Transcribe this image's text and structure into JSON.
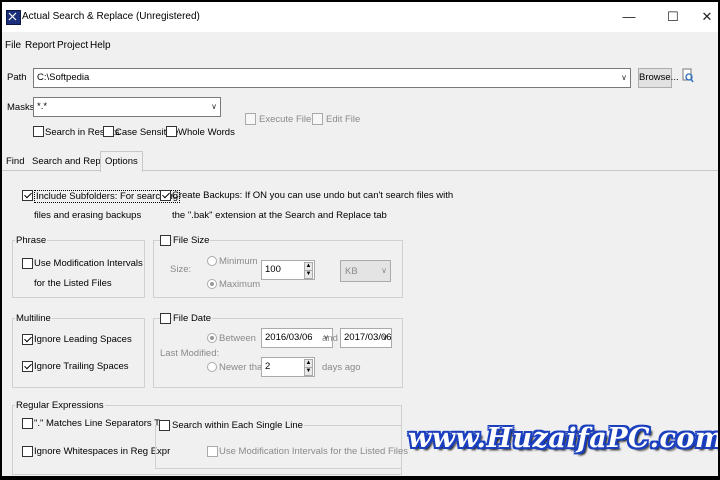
{
  "window": {
    "title": "Actual Search & Replace (Unregistered)"
  },
  "menu": {
    "file": "File",
    "report": "Report",
    "project": "Project",
    "help": "Help"
  },
  "path": {
    "label": "Path",
    "value": "C:\\Softpedia",
    "browse_label": "Browse..."
  },
  "masks": {
    "label": "Masks",
    "value": "*.*"
  },
  "search_opts": {
    "in_results": "Search in Results",
    "case_sensitive": "Case Sensitive",
    "whole_words": "Whole Words"
  },
  "actions": {
    "execute": "Execute File",
    "edit": "Edit File"
  },
  "tabs": [
    "Find",
    "Search and Replace",
    "Options"
  ],
  "options": {
    "include_subfolders_1": "Include Subfolders: For searching",
    "include_subfolders_2": "files and erasing backups",
    "create_backups_1": "Create Backups: If ON you can use undo but can't search files with",
    "create_backups_2": "the \".bak\" extension at the Search and Replace tab",
    "phrase": {
      "title": "Phrase",
      "mod_intervals_1": "Use Modification Intervals",
      "mod_intervals_2": "for the Listed Files"
    },
    "file_size": {
      "title": "File Size",
      "size_label": "Size:",
      "minimum": "Minimum",
      "maximum": "Maximum",
      "value": "100",
      "unit": "KB"
    },
    "multiline": {
      "title": "Multiline",
      "ignore_leading": "Ignore Leading Spaces",
      "ignore_trailing": "Ignore Trailing Spaces"
    },
    "file_date": {
      "title": "File Date",
      "last_modified": "Last Modified:",
      "between": "Between",
      "date_from": "2016/03/06",
      "and": "and",
      "date_to": "2017/03/06",
      "newer_than": "Newer than",
      "days_value": "2",
      "days_ago": "days ago"
    },
    "regex": {
      "title": "Regular Expressions",
      "dot_matches": "\".\" Matches Line Separators Too",
      "ignore_ws": "Ignore Whitespaces in Reg Expr",
      "each_line": "Search within Each Single Line",
      "mod_intervals": "Use Modification Intervals for the Listed Files"
    }
  },
  "watermark": "www.HuzaifaPC.com"
}
